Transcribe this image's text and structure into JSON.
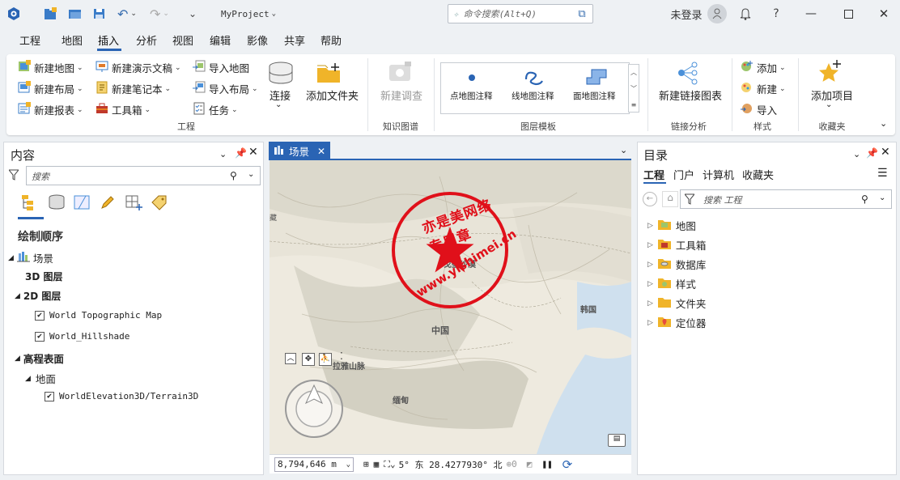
{
  "titlebar": {
    "project": "MyProject",
    "search_placeholder": "命令搜索(Alt+Q)",
    "login": "未登录",
    "help": "?"
  },
  "menu": [
    "工程",
    "地图",
    "插入",
    "分析",
    "视图",
    "编辑",
    "影像",
    "共享",
    "帮助"
  ],
  "ribbon": {
    "project": {
      "new_map": "新建地图",
      "new_presentation": "新建演示文稿",
      "import_map": "导入地图",
      "new_layout": "新建布局",
      "new_notebook": "新建笔记本",
      "import_layout": "导入布局",
      "new_report": "新建报表",
      "toolbox": "工具箱",
      "task": "任务",
      "connect": "连接",
      "add_folder": "添加文件夹",
      "group": "工程"
    },
    "knowledge": {
      "new_survey": "新建调查",
      "group": "知识图谱"
    },
    "layer_templates": {
      "point": "点地图注释",
      "line": "线地图注释",
      "polygon": "面地图注释",
      "group": "图层模板"
    },
    "link": {
      "new_link_chart": "新建链接图表",
      "group": "链接分析"
    },
    "styles": {
      "add": "添加",
      "new": "新建",
      "import": "导入",
      "group": "样式"
    },
    "favorites": {
      "add_item": "添加项目",
      "group": "收藏夹"
    }
  },
  "contents": {
    "title": "内容",
    "search_placeholder": "搜索",
    "draw_order": "绘制顺序",
    "scene": "场景",
    "layers3d": "3D 图层",
    "layers2d": "2D 图层",
    "layer1": "World Topographic Map",
    "layer2": "World_Hillshade",
    "elevation": "高程表面",
    "ground": "地面",
    "terrain": "WorldElevation3D/Terrain3D"
  },
  "map": {
    "tab": "场景",
    "labels": {
      "gobi": "戈壁沙漠",
      "china": "中国",
      "korea": "韩国",
      "himalaya": "拉雅山脉",
      "myanmar": "缅甸"
    },
    "watermark_url": "www.yishimei.cn",
    "watermark_text": "亦是美网络专用章"
  },
  "status": {
    "scale": "8,794,646 m",
    "coord": "5° 东 28.4277930° 北",
    "count": "0"
  },
  "catalog": {
    "title": "目录",
    "tabs": [
      "工程",
      "门户",
      "计算机",
      "收藏夹"
    ],
    "search_placeholder": "搜索 工程",
    "items": [
      "地图",
      "工具箱",
      "数据库",
      "样式",
      "文件夹",
      "定位器"
    ]
  }
}
